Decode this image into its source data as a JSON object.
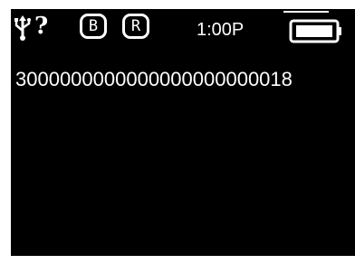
{
  "status_bar": {
    "usb_icon": "usb-icon",
    "unknown_indicator": "?",
    "badges": [
      {
        "label": "B"
      },
      {
        "label": "R"
      }
    ],
    "time": "1:00P",
    "battery_icon": "battery-full-icon"
  },
  "main": {
    "value_text": "3000000000000000000000018"
  },
  "colors": {
    "background": "#000000",
    "foreground": "#ffffff"
  }
}
